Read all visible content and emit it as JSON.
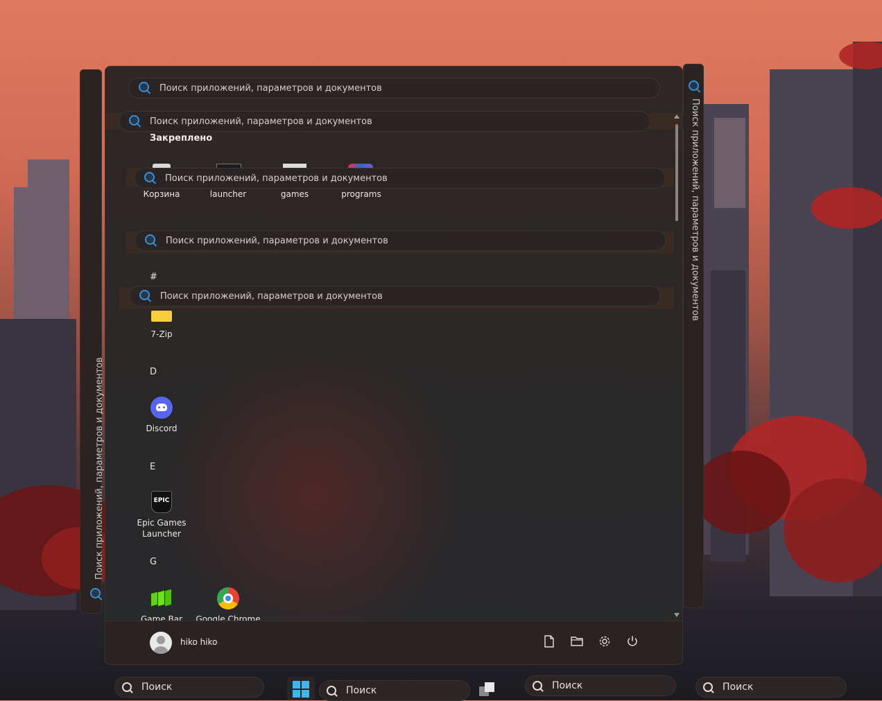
{
  "search_placeholder": "Поиск приложений, параметров и документов",
  "pinned_section": {
    "title": "Закреплено",
    "items": [
      {
        "label": "Корзина",
        "icon": "recycle-bin-icon"
      },
      {
        "label": "launcher",
        "icon": "epic-launcher-icon"
      },
      {
        "label": "games",
        "icon": "games-folder-icon"
      },
      {
        "label": "programs",
        "icon": "programs-folder-icon"
      }
    ]
  },
  "all_apps": {
    "groups": [
      {
        "letter": "#",
        "apps": [
          {
            "label": "7-Zip",
            "icon": "folder-icon"
          }
        ]
      },
      {
        "letter": "D",
        "apps": [
          {
            "label": "Discord",
            "icon": "discord-icon"
          }
        ]
      },
      {
        "letter": "E",
        "apps": [
          {
            "label": "Epic Games Launcher",
            "icon": "epic-games-icon"
          }
        ]
      },
      {
        "letter": "G",
        "apps": [
          {
            "label": "Game Bar",
            "icon": "game-bar-icon"
          },
          {
            "label": "Google Chrome",
            "icon": "chrome-icon"
          }
        ]
      }
    ]
  },
  "epic_logo_text": "EPIC",
  "footer": {
    "username": "hiko hiko",
    "buttons": [
      "document-icon",
      "folder-icon",
      "gear-icon",
      "power-icon"
    ]
  },
  "taskbar": {
    "search_label": "Поиск"
  },
  "colors": {
    "accent": "#3b8fd6",
    "menu_bg": "#2a2726",
    "windows_logo": "#3fb6f0"
  }
}
